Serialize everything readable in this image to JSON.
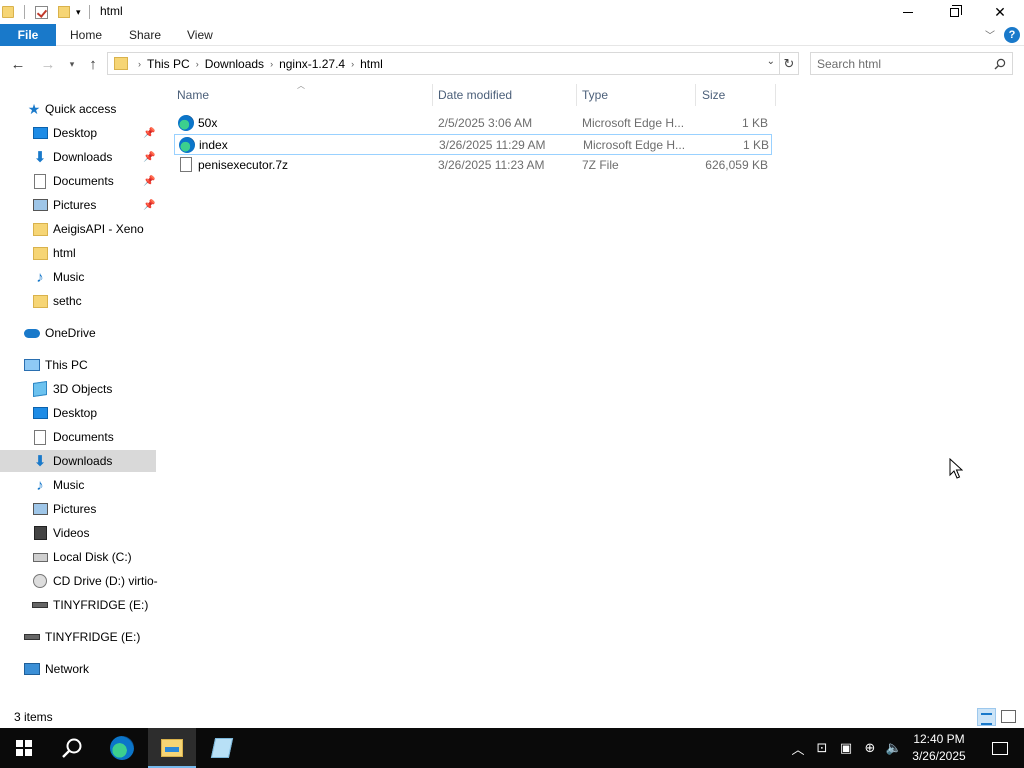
{
  "window": {
    "title": "html"
  },
  "ribbon": {
    "tabs": [
      "File",
      "Home",
      "Share",
      "View"
    ]
  },
  "address": {
    "crumbs": [
      "This PC",
      "Downloads",
      "nginx-1.27.4",
      "html"
    ]
  },
  "search": {
    "placeholder": "Search html"
  },
  "nav": {
    "quick_access": "Quick access",
    "quick_items": [
      "Desktop",
      "Downloads",
      "Documents",
      "Pictures",
      "AeigisAPI - Xeno",
      "html",
      "Music",
      "sethc"
    ],
    "onedrive": "OneDrive",
    "this_pc": "This PC",
    "pc_items": [
      "3D Objects",
      "Desktop",
      "Documents",
      "Downloads",
      "Music",
      "Pictures",
      "Videos",
      "Local Disk (C:)",
      "CD Drive (D:) virtio-",
      "TINYFRIDGE (E:)"
    ],
    "drive": "TINYFRIDGE (E:)",
    "network": "Network"
  },
  "columns": {
    "name": "Name",
    "date": "Date modified",
    "type": "Type",
    "size": "Size"
  },
  "files": [
    {
      "name": "50x",
      "date": "2/5/2025 3:06 AM",
      "type": "Microsoft Edge H...",
      "size": "1 KB",
      "icon": "edge-html-icon"
    },
    {
      "name": "index",
      "date": "3/26/2025 11:29 AM",
      "type": "Microsoft Edge H...",
      "size": "1 KB",
      "icon": "edge-html-icon"
    },
    {
      "name": "penisexecutor.7z",
      "date": "3/26/2025 11:23 AM",
      "type": "7Z File",
      "size": "626,059 KB",
      "icon": "file-icon"
    }
  ],
  "status": {
    "items": "3 items"
  },
  "clock": {
    "time": "12:40 PM",
    "date": "3/26/2025"
  },
  "colors": {
    "accent": "#1979ca",
    "selection": "#cce8ff",
    "taskbar": "#0a0a0a"
  }
}
